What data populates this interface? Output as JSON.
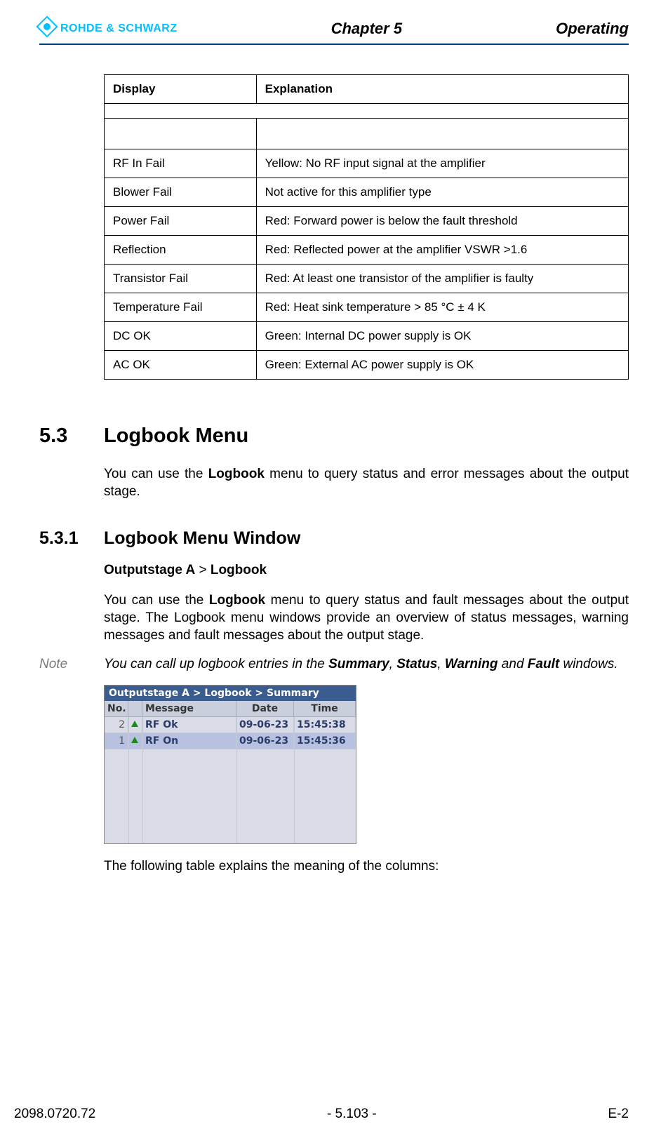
{
  "header": {
    "logo_text": "ROHDE & SCHWARZ",
    "chapter": "Chapter 5",
    "section": "Operating"
  },
  "table": {
    "headers": {
      "display": "Display",
      "explanation": "Explanation"
    },
    "rows": [
      {
        "display": "RF In Fail",
        "explanation": "Yellow: No RF input signal at the amplifier"
      },
      {
        "display": "Blower Fail",
        "explanation": "Not active for this amplifier type"
      },
      {
        "display": "Power Fail",
        "explanation": "Red: Forward power is below the fault threshold"
      },
      {
        "display": "Reflection",
        "explanation": "Red: Reflected power at the amplifier VSWR >1.6"
      },
      {
        "display": "Transistor Fail",
        "explanation": "Red: At least one transistor of the amplifier is faulty"
      },
      {
        "display": "Temperature Fail",
        "explanation": "Red: Heat sink temperature > 85 °C ± 4 K"
      },
      {
        "display": "DC OK",
        "explanation": "Green: Internal DC power supply is OK"
      },
      {
        "display": "AC OK",
        "explanation": "Green: External AC power supply is OK"
      }
    ]
  },
  "s53": {
    "num": "5.3",
    "title": "Logbook Menu",
    "intro_pre": "You can use the ",
    "intro_bold": "Logbook",
    "intro_post": " menu to query status and error messages about the output stage."
  },
  "s531": {
    "num": "5.3.1",
    "title": "Logbook Menu Window",
    "breadcrumb_a": "Outputstage A",
    "breadcrumb_sep": " > ",
    "breadcrumb_b": "Logbook",
    "p1_pre": "You can use the ",
    "p1_bold": "Logbook",
    "p1_post": " menu to query status and fault messages about the output stage. The Logbook menu windows provide an overview of status messages, warning messages and fault messages about the output stage.",
    "note_label": "Note",
    "note_pre": "You can call up logbook entries in the ",
    "note_b1": "Summary",
    "note_s1": ", ",
    "note_b2": "Status",
    "note_s2": ", ",
    "note_b3": "Warning",
    "note_s3": " and ",
    "note_b4": "Fault",
    "note_post": " windows.",
    "after_shot": "The following table explains the meaning of the columns:"
  },
  "shot": {
    "title": "Outputstage A  > Logbook > Summary",
    "cols": {
      "no": "No.",
      "msg": "Message",
      "date": "Date",
      "time": "Time"
    },
    "rows": [
      {
        "no": "2",
        "msg": "RF Ok",
        "date": "09-06-23",
        "time": "15:45:38"
      },
      {
        "no": "1",
        "msg": "RF On",
        "date": "09-06-23",
        "time": "15:45:36"
      }
    ]
  },
  "footer": {
    "left": "2098.0720.72",
    "center": "- 5.103 -",
    "right": "E-2"
  },
  "chart_data": {
    "type": "table",
    "title": "Display / Explanation",
    "columns": [
      "Display",
      "Explanation"
    ],
    "rows": [
      [
        "RF In Fail",
        "Yellow: No RF input signal at the amplifier"
      ],
      [
        "Blower Fail",
        "Not active for this amplifier type"
      ],
      [
        "Power Fail",
        "Red: Forward power is below the fault threshold"
      ],
      [
        "Reflection",
        "Red: Reflected power at the amplifier VSWR >1.6"
      ],
      [
        "Transistor Fail",
        "Red: At least one transistor of the amplifier is faulty"
      ],
      [
        "Temperature Fail",
        "Red: Heat sink temperature > 85 °C ± 4 K"
      ],
      [
        "DC OK",
        "Green: Internal DC power supply is OK"
      ],
      [
        "AC OK",
        "Green: External AC power supply is OK"
      ]
    ]
  }
}
